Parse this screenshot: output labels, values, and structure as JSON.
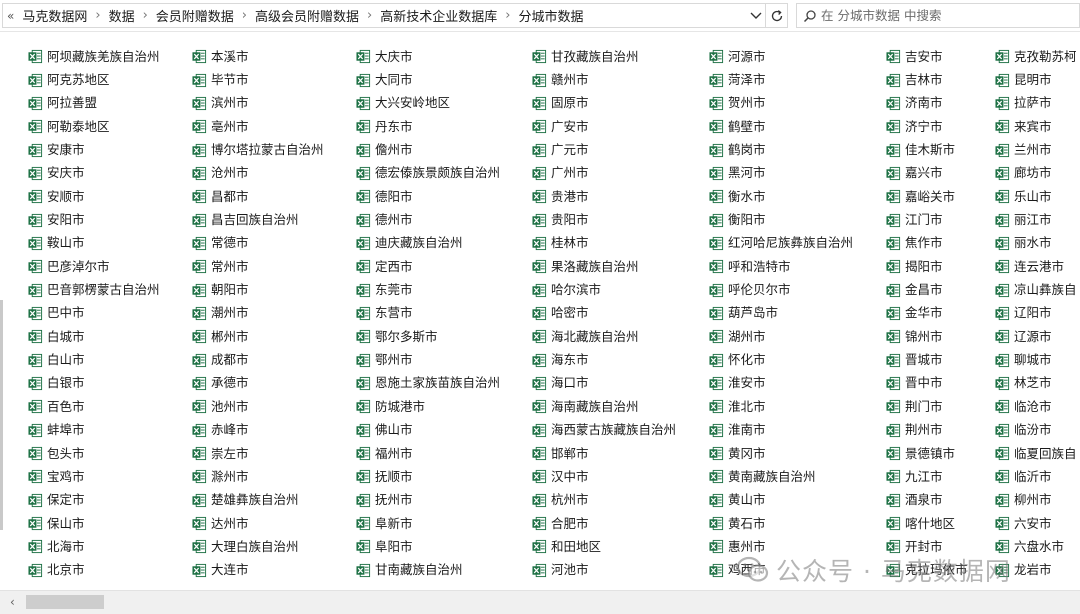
{
  "address_bar": {
    "back_glyph": "«",
    "breadcrumbs": [
      "马克数据网",
      "数据",
      "会员附赠数据",
      "高级会员附赠数据",
      "高新技术企业数据库",
      "分城市数据"
    ]
  },
  "search": {
    "placeholder": "在 分城市数据 中搜索"
  },
  "watermark": {
    "text": "公众号 · 马克数据网"
  },
  "colors": {
    "excel_green": "#1e7145",
    "excel_light": "#ffffff",
    "text": "#1a1a1a"
  },
  "columns": [
    [
      "阿坝藏族羌族自治州",
      "阿克苏地区",
      "阿拉善盟",
      "阿勒泰地区",
      "安康市",
      "安庆市",
      "安顺市",
      "安阳市",
      "鞍山市",
      "巴彦淖尔市",
      "巴音郭楞蒙古自治州",
      "巴中市",
      "白城市",
      "白山市",
      "白银市",
      "百色市",
      "蚌埠市",
      "包头市",
      "宝鸡市",
      "保定市",
      "保山市",
      "北海市",
      "北京市"
    ],
    [
      "本溪市",
      "毕节市",
      "滨州市",
      "亳州市",
      "博尔塔拉蒙古自治州",
      "沧州市",
      "昌都市",
      "昌吉回族自治州",
      "常德市",
      "常州市",
      "朝阳市",
      "潮州市",
      "郴州市",
      "成都市",
      "承德市",
      "池州市",
      "赤峰市",
      "崇左市",
      "滁州市",
      "楚雄彝族自治州",
      "达州市",
      "大理白族自治州",
      "大连市"
    ],
    [
      "大庆市",
      "大同市",
      "大兴安岭地区",
      "丹东市",
      "儋州市",
      "德宏傣族景颇族自治州",
      "德阳市",
      "德州市",
      "迪庆藏族自治州",
      "定西市",
      "东莞市",
      "东营市",
      "鄂尔多斯市",
      "鄂州市",
      "恩施土家族苗族自治州",
      "防城港市",
      "佛山市",
      "福州市",
      "抚顺市",
      "抚州市",
      "阜新市",
      "阜阳市",
      "甘南藏族自治州"
    ],
    [
      "甘孜藏族自治州",
      "赣州市",
      "固原市",
      "广安市",
      "广元市",
      "广州市",
      "贵港市",
      "贵阳市",
      "桂林市",
      "果洛藏族自治州",
      "哈尔滨市",
      "哈密市",
      "海北藏族自治州",
      "海东市",
      "海口市",
      "海南藏族自治州",
      "海西蒙古族藏族自治州",
      "邯郸市",
      "汉中市",
      "杭州市",
      "合肥市",
      "和田地区",
      "河池市"
    ],
    [
      "河源市",
      "菏泽市",
      "贺州市",
      "鹤壁市",
      "鹤岗市",
      "黑河市",
      "衡水市",
      "衡阳市",
      "红河哈尼族彝族自治州",
      "呼和浩特市",
      "呼伦贝尔市",
      "葫芦岛市",
      "湖州市",
      "怀化市",
      "淮安市",
      "淮北市",
      "淮南市",
      "黄冈市",
      "黄南藏族自治州",
      "黄山市",
      "黄石市",
      "惠州市",
      "鸡西市"
    ],
    [
      "吉安市",
      "吉林市",
      "济南市",
      "济宁市",
      "佳木斯市",
      "嘉兴市",
      "嘉峪关市",
      "江门市",
      "焦作市",
      "揭阳市",
      "金昌市",
      "金华市",
      "锦州市",
      "晋城市",
      "晋中市",
      "荆门市",
      "荆州市",
      "景德镇市",
      "九江市",
      "酒泉市",
      "喀什地区",
      "开封市",
      "克拉玛依市"
    ],
    [
      "克孜勒苏柯",
      "昆明市",
      "拉萨市",
      "来宾市",
      "兰州市",
      "廊坊市",
      "乐山市",
      "丽江市",
      "丽水市",
      "连云港市",
      "凉山彝族自",
      "辽阳市",
      "辽源市",
      "聊城市",
      "林芝市",
      "临沧市",
      "临汾市",
      "临夏回族自",
      "临沂市",
      "柳州市",
      "六安市",
      "六盘水市",
      "龙岩市"
    ]
  ]
}
